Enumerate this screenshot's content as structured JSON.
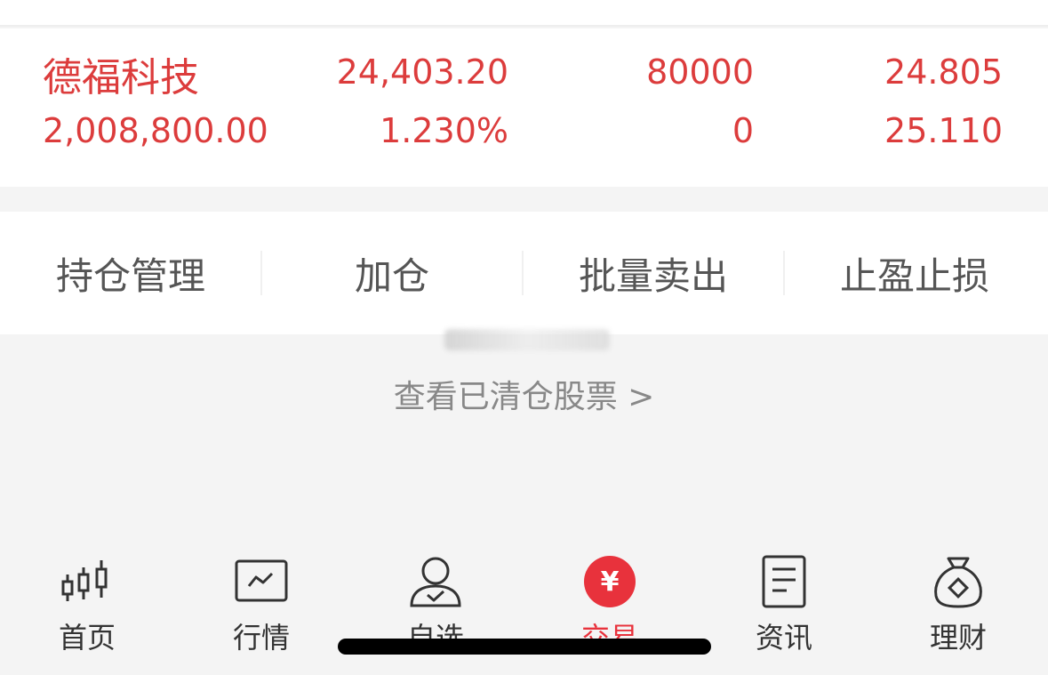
{
  "position": {
    "name": "德福科技",
    "market_value": "2,008,800.00",
    "profit": "24,403.20",
    "profit_pct": "1.230%",
    "holding": "80000",
    "available": "0",
    "cost": "24.805",
    "price": "25.110"
  },
  "actions": [
    {
      "label": "持仓管理"
    },
    {
      "label": "加仓"
    },
    {
      "label": "批量卖出"
    },
    {
      "label": "止盈止损"
    }
  ],
  "cleared_link": "查看已清仓股票 >",
  "tabs": [
    {
      "label": "首页",
      "icon": "candlestick-icon"
    },
    {
      "label": "行情",
      "icon": "chart-icon"
    },
    {
      "label": "自选",
      "icon": "user-check-icon"
    },
    {
      "label": "交易",
      "icon": "yen-icon",
      "badge": "¥",
      "active": true
    },
    {
      "label": "资讯",
      "icon": "document-icon"
    },
    {
      "label": "理财",
      "icon": "money-bag-icon"
    }
  ],
  "colors": {
    "accent": "#e8323c",
    "value_red": "#dc3c3c",
    "muted": "#888888"
  }
}
